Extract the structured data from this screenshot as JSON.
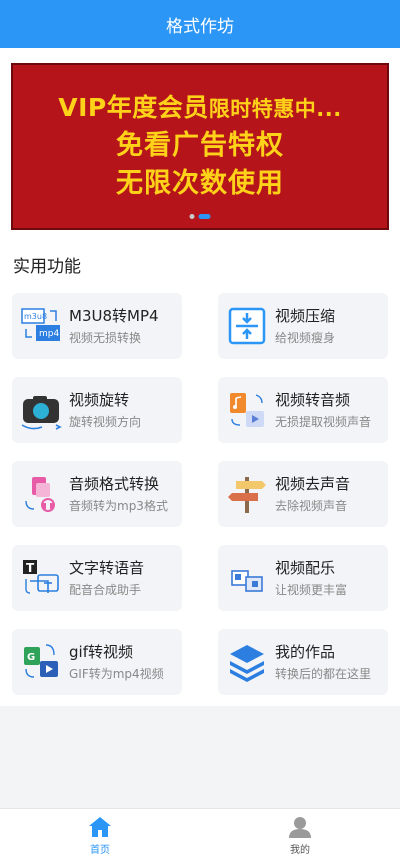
{
  "header": {
    "title": "格式作坊"
  },
  "banner": {
    "line1_main": "VIP年度会员",
    "line1_small": "限时特惠中...",
    "line2": "免看广告特权",
    "line3": "无限次数使用"
  },
  "section": {
    "title": "实用功能"
  },
  "features": [
    {
      "title": "M3U8转MP4",
      "subtitle": "视频无损转换",
      "icon": "m3u8-mp4-icon"
    },
    {
      "title": "视频压缩",
      "subtitle": "给视频瘦身",
      "icon": "compress-icon"
    },
    {
      "title": "视频旋转",
      "subtitle": "旋转视频方向",
      "icon": "camera-rotate-icon"
    },
    {
      "title": "视频转音频",
      "subtitle": "无损提取视频声音",
      "icon": "video-to-audio-icon"
    },
    {
      "title": "音频格式转换",
      "subtitle": "音频转为mp3格式",
      "icon": "audio-convert-icon"
    },
    {
      "title": "视频去声音",
      "subtitle": "去除视频声音",
      "icon": "signpost-icon"
    },
    {
      "title": "文字转语音",
      "subtitle": "配音合成助手",
      "icon": "text-to-speech-icon"
    },
    {
      "title": "视频配乐",
      "subtitle": "让视频更丰富",
      "icon": "video-music-icon"
    },
    {
      "title": "gif转视频",
      "subtitle": "GIF转为mp4视频",
      "icon": "gif-to-video-icon"
    },
    {
      "title": "我的作品",
      "subtitle": "转换后的都在这里",
      "icon": "layers-icon"
    }
  ],
  "icon_text": {
    "m3u8": "m3u8",
    "mp4": "mp4",
    "t": "T",
    "g": "G"
  },
  "tabbar": {
    "home_label": "首页",
    "mine_label": "我的"
  },
  "colors": {
    "primary": "#2c96f6",
    "banner_bg": "#b5141a",
    "banner_text": "#ffd21a"
  }
}
